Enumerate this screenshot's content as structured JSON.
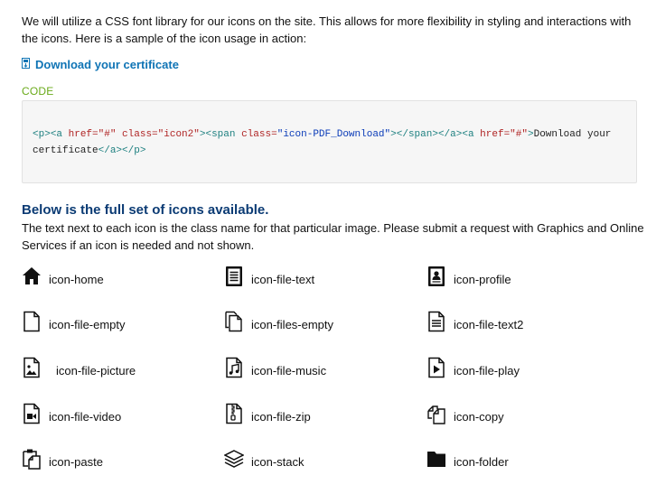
{
  "intro": {
    "text": "We will utilize a CSS font library for our icons on the site. This allows for more flexibility in styling and interactions with the icons. Here is a sample of the icon usage in action:"
  },
  "download_link": {
    "icon": "pdf-download-icon",
    "label": "Download your certificate",
    "color": "#0f74b5"
  },
  "code_section": {
    "label": "CODE",
    "line1": {
      "p_open": "<p>",
      "a_open": "<a",
      "href_attr": " href=",
      "href_val": "\"#\"",
      "class_attr": " class=",
      "class_val": "\"icon2\"",
      "gt": ">",
      "span_open": "<span",
      "span_class_attr": " class=",
      "span_class_val": "\"icon-PDF_Download\"",
      "span_close": "></span></a>",
      "a2_open": "<a",
      "a2_href_attr": " href=",
      "a2_href_val": "\"#\"",
      "a2_gt": ">",
      "text": "Download your"
    },
    "line2": {
      "text": "certificate",
      "closing": "</a></p>"
    }
  },
  "icon_section": {
    "heading": "Below is the full set of icons available.",
    "description": "The text next to each icon is the class name for that particular image. Please submit a request with Graphics and Online Services if an icon is needed and not shown.",
    "heading_color": "#0b3b74"
  },
  "icons": [
    {
      "name": "icon-home"
    },
    {
      "name": "icon-file-text"
    },
    {
      "name": "icon-profile"
    },
    {
      "name": "icon-file-empty"
    },
    {
      "name": "icon-files-empty"
    },
    {
      "name": "icon-file-text2"
    },
    {
      "name": "icon-file-picture"
    },
    {
      "name": "icon-file-music"
    },
    {
      "name": "icon-file-play"
    },
    {
      "name": "icon-file-video"
    },
    {
      "name": "icon-file-zip"
    },
    {
      "name": "icon-copy"
    },
    {
      "name": "icon-paste"
    },
    {
      "name": "icon-stack"
    },
    {
      "name": "icon-folder"
    }
  ]
}
